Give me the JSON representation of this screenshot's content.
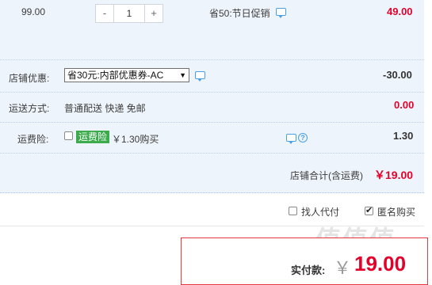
{
  "item": {
    "unit_price": "99.00",
    "qty_minus": "-",
    "qty_value": "1",
    "qty_plus": "+",
    "promo": "省50:节日促销",
    "subtotal": "49.00"
  },
  "shop_discount": {
    "label": "店铺优惠:",
    "selected": "省30元:内部优惠券-AC",
    "amount": "-30.00"
  },
  "shipping": {
    "label": "运送方式:",
    "method": "普通配送 快递 免邮",
    "amount": "0.00"
  },
  "insurance": {
    "label": "运费险:",
    "badge": "运费险",
    "desc": "￥1.30购买",
    "amount": "1.30"
  },
  "shop_total": {
    "label": "店铺合计(含运费)",
    "amount": "￥19.00"
  },
  "options": {
    "proxy_pay": "找人代付",
    "anonymous": "匿名购买",
    "anonymous_checked": true
  },
  "payment": {
    "label": "实付款:",
    "currency": "￥",
    "amount": "19.00"
  },
  "watermark": "值值值",
  "colors": {
    "accent_red": "#e4002b",
    "panel_bg": "#eef4fb",
    "link_blue": "#4aa0e6",
    "badge_green": "#3bab4c"
  }
}
